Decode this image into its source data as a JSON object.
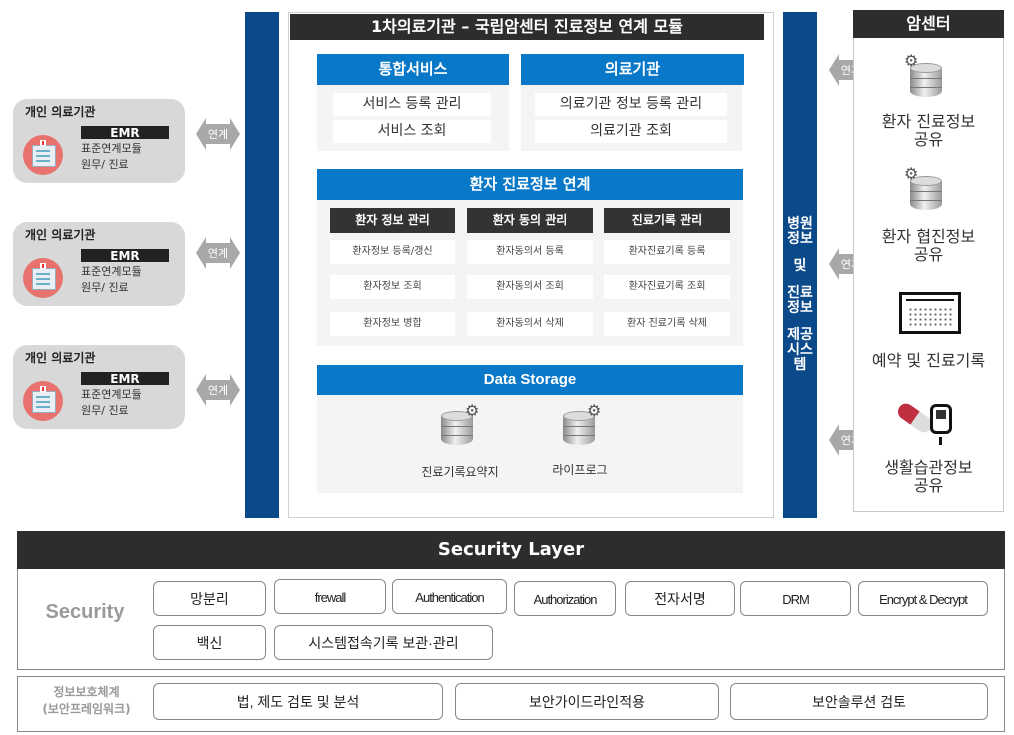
{
  "clinics": [
    {
      "title": "개인 의료기관",
      "badge": "EMR",
      "line1": "표준연계모듈",
      "line2": "원무/ 진료",
      "link": "연계"
    },
    {
      "title": "개인 의료기관",
      "badge": "EMR",
      "line1": "표준연계모듈",
      "line2": "원무/ 진료",
      "link": "연계"
    },
    {
      "title": "개인 의료기관",
      "badge": "EMR",
      "line1": "표준연계모듈",
      "line2": "원무/ 진료",
      "link": "연계"
    }
  ],
  "module": {
    "title": "1차의료기관 – 국립암센터 진료정보 연계 모듈",
    "integrated": {
      "header": "통합서비스",
      "items": [
        "서비스 등록 관리",
        "서비스 조회"
      ]
    },
    "institution": {
      "header": "의료기관",
      "items": [
        "의료기관 정보 등록 관리",
        "의료기관 조회"
      ]
    },
    "patient_link": {
      "header": "환자 진료정보 연계",
      "columns": [
        {
          "header": "환자 정보 관리",
          "items": [
            "환자정보 등록/갱신",
            "환자정보 조회",
            "환자정보 병합"
          ]
        },
        {
          "header": "환자 동의 관리",
          "items": [
            "환자동의서 등록",
            "환자동의서 조회",
            "환자동의서 삭제"
          ]
        },
        {
          "header": "진료기록 관리",
          "items": [
            "환자진료기록 등록",
            "환자진료기록 조회",
            "환자 진료기록 삭제"
          ]
        }
      ]
    },
    "storage": {
      "header": "Data Storage",
      "items": [
        "진료기록요약지",
        "라이프로그"
      ]
    }
  },
  "side_bar": {
    "chars": [
      "병원",
      "정보",
      "",
      "및",
      "",
      "진료",
      "정보",
      "",
      "제공",
      "시스",
      "템"
    ]
  },
  "cancer_center": {
    "title": "암센터",
    "link": "연계",
    "items": [
      {
        "icon": "database-gear-icon",
        "line1": "환자 진료정보",
        "line2": "공유"
      },
      {
        "icon": "database-gear-icon",
        "line1": "환자 협진정보",
        "line2": "공유"
      },
      {
        "icon": "calendar-icon",
        "line1": "예약 및 진료기록",
        "line2": ""
      },
      {
        "icon": "pill-glucometer-icon",
        "line1": "생활습관정보",
        "line2": "공유"
      }
    ]
  },
  "security": {
    "header": "Security Layer",
    "label": "Security",
    "row1": [
      "망분리",
      "frewall",
      "Authentication",
      "Authorization",
      "전자서명",
      "DRM",
      "Encrypt & Decrypt"
    ],
    "row2": [
      "백신",
      "시스템접속기록 보관·관리"
    ]
  },
  "framework": {
    "label1": "정보보호체계",
    "label2": "(보안프레임워크)",
    "items": [
      "법, 제도 검토 및 분석",
      "보안가이드라인적용",
      "보안솔루션 검토"
    ]
  }
}
